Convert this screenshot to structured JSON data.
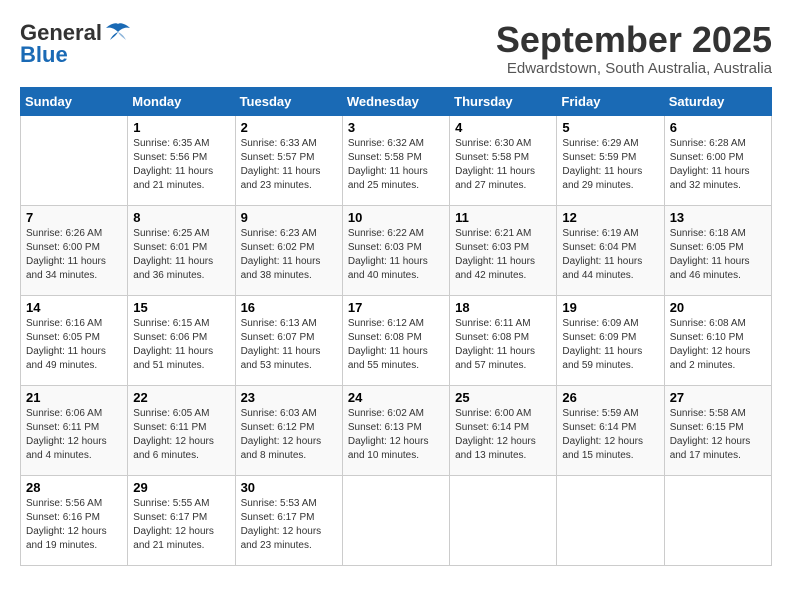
{
  "logo": {
    "general": "General",
    "blue": "Blue"
  },
  "title": "September 2025",
  "location": "Edwardstown, South Australia, Australia",
  "days_header": [
    "Sunday",
    "Monday",
    "Tuesday",
    "Wednesday",
    "Thursday",
    "Friday",
    "Saturday"
  ],
  "weeks": [
    [
      {
        "num": "",
        "sunrise": "",
        "sunset": "",
        "daylight": ""
      },
      {
        "num": "1",
        "sunrise": "Sunrise: 6:35 AM",
        "sunset": "Sunset: 5:56 PM",
        "daylight": "Daylight: 11 hours and 21 minutes."
      },
      {
        "num": "2",
        "sunrise": "Sunrise: 6:33 AM",
        "sunset": "Sunset: 5:57 PM",
        "daylight": "Daylight: 11 hours and 23 minutes."
      },
      {
        "num": "3",
        "sunrise": "Sunrise: 6:32 AM",
        "sunset": "Sunset: 5:58 PM",
        "daylight": "Daylight: 11 hours and 25 minutes."
      },
      {
        "num": "4",
        "sunrise": "Sunrise: 6:30 AM",
        "sunset": "Sunset: 5:58 PM",
        "daylight": "Daylight: 11 hours and 27 minutes."
      },
      {
        "num": "5",
        "sunrise": "Sunrise: 6:29 AM",
        "sunset": "Sunset: 5:59 PM",
        "daylight": "Daylight: 11 hours and 29 minutes."
      },
      {
        "num": "6",
        "sunrise": "Sunrise: 6:28 AM",
        "sunset": "Sunset: 6:00 PM",
        "daylight": "Daylight: 11 hours and 32 minutes."
      }
    ],
    [
      {
        "num": "7",
        "sunrise": "Sunrise: 6:26 AM",
        "sunset": "Sunset: 6:00 PM",
        "daylight": "Daylight: 11 hours and 34 minutes."
      },
      {
        "num": "8",
        "sunrise": "Sunrise: 6:25 AM",
        "sunset": "Sunset: 6:01 PM",
        "daylight": "Daylight: 11 hours and 36 minutes."
      },
      {
        "num": "9",
        "sunrise": "Sunrise: 6:23 AM",
        "sunset": "Sunset: 6:02 PM",
        "daylight": "Daylight: 11 hours and 38 minutes."
      },
      {
        "num": "10",
        "sunrise": "Sunrise: 6:22 AM",
        "sunset": "Sunset: 6:03 PM",
        "daylight": "Daylight: 11 hours and 40 minutes."
      },
      {
        "num": "11",
        "sunrise": "Sunrise: 6:21 AM",
        "sunset": "Sunset: 6:03 PM",
        "daylight": "Daylight: 11 hours and 42 minutes."
      },
      {
        "num": "12",
        "sunrise": "Sunrise: 6:19 AM",
        "sunset": "Sunset: 6:04 PM",
        "daylight": "Daylight: 11 hours and 44 minutes."
      },
      {
        "num": "13",
        "sunrise": "Sunrise: 6:18 AM",
        "sunset": "Sunset: 6:05 PM",
        "daylight": "Daylight: 11 hours and 46 minutes."
      }
    ],
    [
      {
        "num": "14",
        "sunrise": "Sunrise: 6:16 AM",
        "sunset": "Sunset: 6:05 PM",
        "daylight": "Daylight: 11 hours and 49 minutes."
      },
      {
        "num": "15",
        "sunrise": "Sunrise: 6:15 AM",
        "sunset": "Sunset: 6:06 PM",
        "daylight": "Daylight: 11 hours and 51 minutes."
      },
      {
        "num": "16",
        "sunrise": "Sunrise: 6:13 AM",
        "sunset": "Sunset: 6:07 PM",
        "daylight": "Daylight: 11 hours and 53 minutes."
      },
      {
        "num": "17",
        "sunrise": "Sunrise: 6:12 AM",
        "sunset": "Sunset: 6:08 PM",
        "daylight": "Daylight: 11 hours and 55 minutes."
      },
      {
        "num": "18",
        "sunrise": "Sunrise: 6:11 AM",
        "sunset": "Sunset: 6:08 PM",
        "daylight": "Daylight: 11 hours and 57 minutes."
      },
      {
        "num": "19",
        "sunrise": "Sunrise: 6:09 AM",
        "sunset": "Sunset: 6:09 PM",
        "daylight": "Daylight: 11 hours and 59 minutes."
      },
      {
        "num": "20",
        "sunrise": "Sunrise: 6:08 AM",
        "sunset": "Sunset: 6:10 PM",
        "daylight": "Daylight: 12 hours and 2 minutes."
      }
    ],
    [
      {
        "num": "21",
        "sunrise": "Sunrise: 6:06 AM",
        "sunset": "Sunset: 6:11 PM",
        "daylight": "Daylight: 12 hours and 4 minutes."
      },
      {
        "num": "22",
        "sunrise": "Sunrise: 6:05 AM",
        "sunset": "Sunset: 6:11 PM",
        "daylight": "Daylight: 12 hours and 6 minutes."
      },
      {
        "num": "23",
        "sunrise": "Sunrise: 6:03 AM",
        "sunset": "Sunset: 6:12 PM",
        "daylight": "Daylight: 12 hours and 8 minutes."
      },
      {
        "num": "24",
        "sunrise": "Sunrise: 6:02 AM",
        "sunset": "Sunset: 6:13 PM",
        "daylight": "Daylight: 12 hours and 10 minutes."
      },
      {
        "num": "25",
        "sunrise": "Sunrise: 6:00 AM",
        "sunset": "Sunset: 6:14 PM",
        "daylight": "Daylight: 12 hours and 13 minutes."
      },
      {
        "num": "26",
        "sunrise": "Sunrise: 5:59 AM",
        "sunset": "Sunset: 6:14 PM",
        "daylight": "Daylight: 12 hours and 15 minutes."
      },
      {
        "num": "27",
        "sunrise": "Sunrise: 5:58 AM",
        "sunset": "Sunset: 6:15 PM",
        "daylight": "Daylight: 12 hours and 17 minutes."
      }
    ],
    [
      {
        "num": "28",
        "sunrise": "Sunrise: 5:56 AM",
        "sunset": "Sunset: 6:16 PM",
        "daylight": "Daylight: 12 hours and 19 minutes."
      },
      {
        "num": "29",
        "sunrise": "Sunrise: 5:55 AM",
        "sunset": "Sunset: 6:17 PM",
        "daylight": "Daylight: 12 hours and 21 minutes."
      },
      {
        "num": "30",
        "sunrise": "Sunrise: 5:53 AM",
        "sunset": "Sunset: 6:17 PM",
        "daylight": "Daylight: 12 hours and 23 minutes."
      },
      {
        "num": "",
        "sunrise": "",
        "sunset": "",
        "daylight": ""
      },
      {
        "num": "",
        "sunrise": "",
        "sunset": "",
        "daylight": ""
      },
      {
        "num": "",
        "sunrise": "",
        "sunset": "",
        "daylight": ""
      },
      {
        "num": "",
        "sunrise": "",
        "sunset": "",
        "daylight": ""
      }
    ]
  ]
}
